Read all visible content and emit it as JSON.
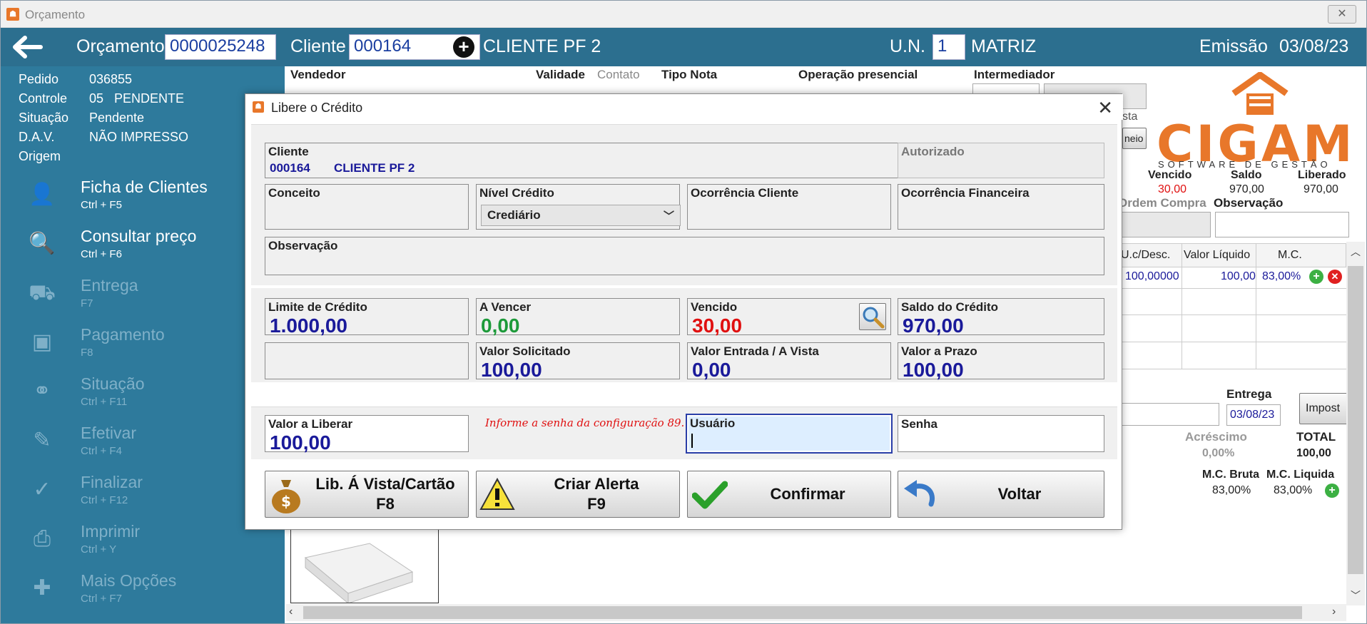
{
  "window": {
    "title": "Orçamento"
  },
  "header": {
    "orcamento_label": "Orçamento",
    "orcamento_value": "0000025248",
    "cliente_label": "Cliente",
    "cliente_code": "000164",
    "cliente_name": "CLIENTE PF 2",
    "un_label": "U.N.",
    "un_value": "1",
    "un_name": "MATRIZ",
    "emissao_label": "Emissão",
    "emissao_date": "03/08/23"
  },
  "sidebar": {
    "info": [
      {
        "label": "Pedido",
        "value": "036855"
      },
      {
        "label": "Controle",
        "value": "05   PENDENTE"
      },
      {
        "label": "Situação",
        "value": "Pendente"
      },
      {
        "label": "D.A.V.",
        "value": "NÃO IMPRESSO"
      },
      {
        "label": "Origem",
        "value": ""
      }
    ],
    "menu": [
      {
        "label": "Ficha de Clientes",
        "shortcut": "Ctrl + F5",
        "icon": "user-icon"
      },
      {
        "label": "Consultar preço",
        "shortcut": "Ctrl + F6",
        "icon": "price-search-icon"
      },
      {
        "label": "Entrega",
        "shortcut": "F7",
        "icon": "truck-icon"
      },
      {
        "label": "Pagamento",
        "shortcut": "F8",
        "icon": "money-icon"
      },
      {
        "label": "Situação",
        "shortcut": "Ctrl + F11",
        "icon": "link-icon"
      },
      {
        "label": "Efetivar",
        "shortcut": "Ctrl + F4",
        "icon": "edit-doc-icon"
      },
      {
        "label": "Finalizar",
        "shortcut": "Ctrl + F12",
        "icon": "check-icon"
      },
      {
        "label": "Imprimir",
        "shortcut": "Ctrl + Y",
        "icon": "printer-icon"
      },
      {
        "label": "Mais Opções",
        "shortcut": "Ctrl + F7",
        "icon": "plus-icon"
      }
    ]
  },
  "background": {
    "headers": {
      "vendedor": "Vendedor",
      "validade": "Validade",
      "contato": "Contato",
      "tipo_nota": "Tipo Nota",
      "operacao": "Operação presencial",
      "intermediador": "Intermediador"
    },
    "vencido_label": "Vencido",
    "saldo_label": "Saldo",
    "liberado_label": "Liberado",
    "vencido_value": "30,00",
    "saldo_value": "970,00",
    "liberado_value": "970,00",
    "ordem_compra_label": "Ordem Compra",
    "observacao_label": "Observação",
    "sta_text": "sta",
    "neio_text": "neio",
    "grid_headers": [
      "U.c/Desc.",
      "Valor Líquido",
      "M.C."
    ],
    "grid_row": [
      "100,00000",
      "100,00",
      "83,00%"
    ],
    "entrega_label": "Entrega",
    "entrega_date": "03/08/23",
    "impost_label": "Impost",
    "acrescimo_label": "Acréscimo",
    "acrescimo_value": "0,00%",
    "total_label": "TOTAL",
    "total_value": "100,00",
    "mc_bruta_label": "M.C. Bruta",
    "mc_liquida_label": "M.C. Liquida",
    "mc_bruta_value": "83,00%",
    "mc_liquida_value": "83,00%",
    "logo_text": "CIGAM",
    "logo_sub": "SOFTWARE DE GESTÃO"
  },
  "dialog": {
    "title": "Libere o Crédito",
    "cliente_label": "Cliente",
    "cliente_code": "000164",
    "cliente_name": "CLIENTE PF 2",
    "autorizado_label": "Autorizado",
    "conceito_label": "Conceito",
    "nivel_label": "Nível Crédito",
    "nivel_value": "Crediário",
    "ocorr_cliente_label": "Ocorrência Cliente",
    "ocorr_fin_label": "Ocorrência Financeira",
    "observacao_label": "Observação",
    "limite_label": "Limite de Crédito",
    "limite_value": "1.000,00",
    "avencer_label": "A Vencer",
    "avencer_value": "0,00",
    "vencido_label": "Vencido",
    "vencido_value": "30,00",
    "saldo_label": "Saldo do Crédito",
    "saldo_value": "970,00",
    "solicitado_label": "Valor Solicitado",
    "solicitado_value": "100,00",
    "entrada_label": "Valor Entrada / A Vista",
    "entrada_value": "0,00",
    "prazo_label": "Valor a Prazo",
    "prazo_value": "100,00",
    "liberar_label": "Valor a Liberar",
    "liberar_value": "100,00",
    "hint": "Informe a senha da configuração 89.",
    "usuario_label": "Usuário",
    "usuario_value": "",
    "senha_label": "Senha",
    "senha_value": "",
    "buttons": {
      "lib_line1": "Lib. Á Vista/Cartão",
      "lib_line2": "F8",
      "alerta_line1": "Criar Alerta",
      "alerta_line2": "F9",
      "confirmar": "Confirmar",
      "voltar": "Voltar"
    }
  }
}
